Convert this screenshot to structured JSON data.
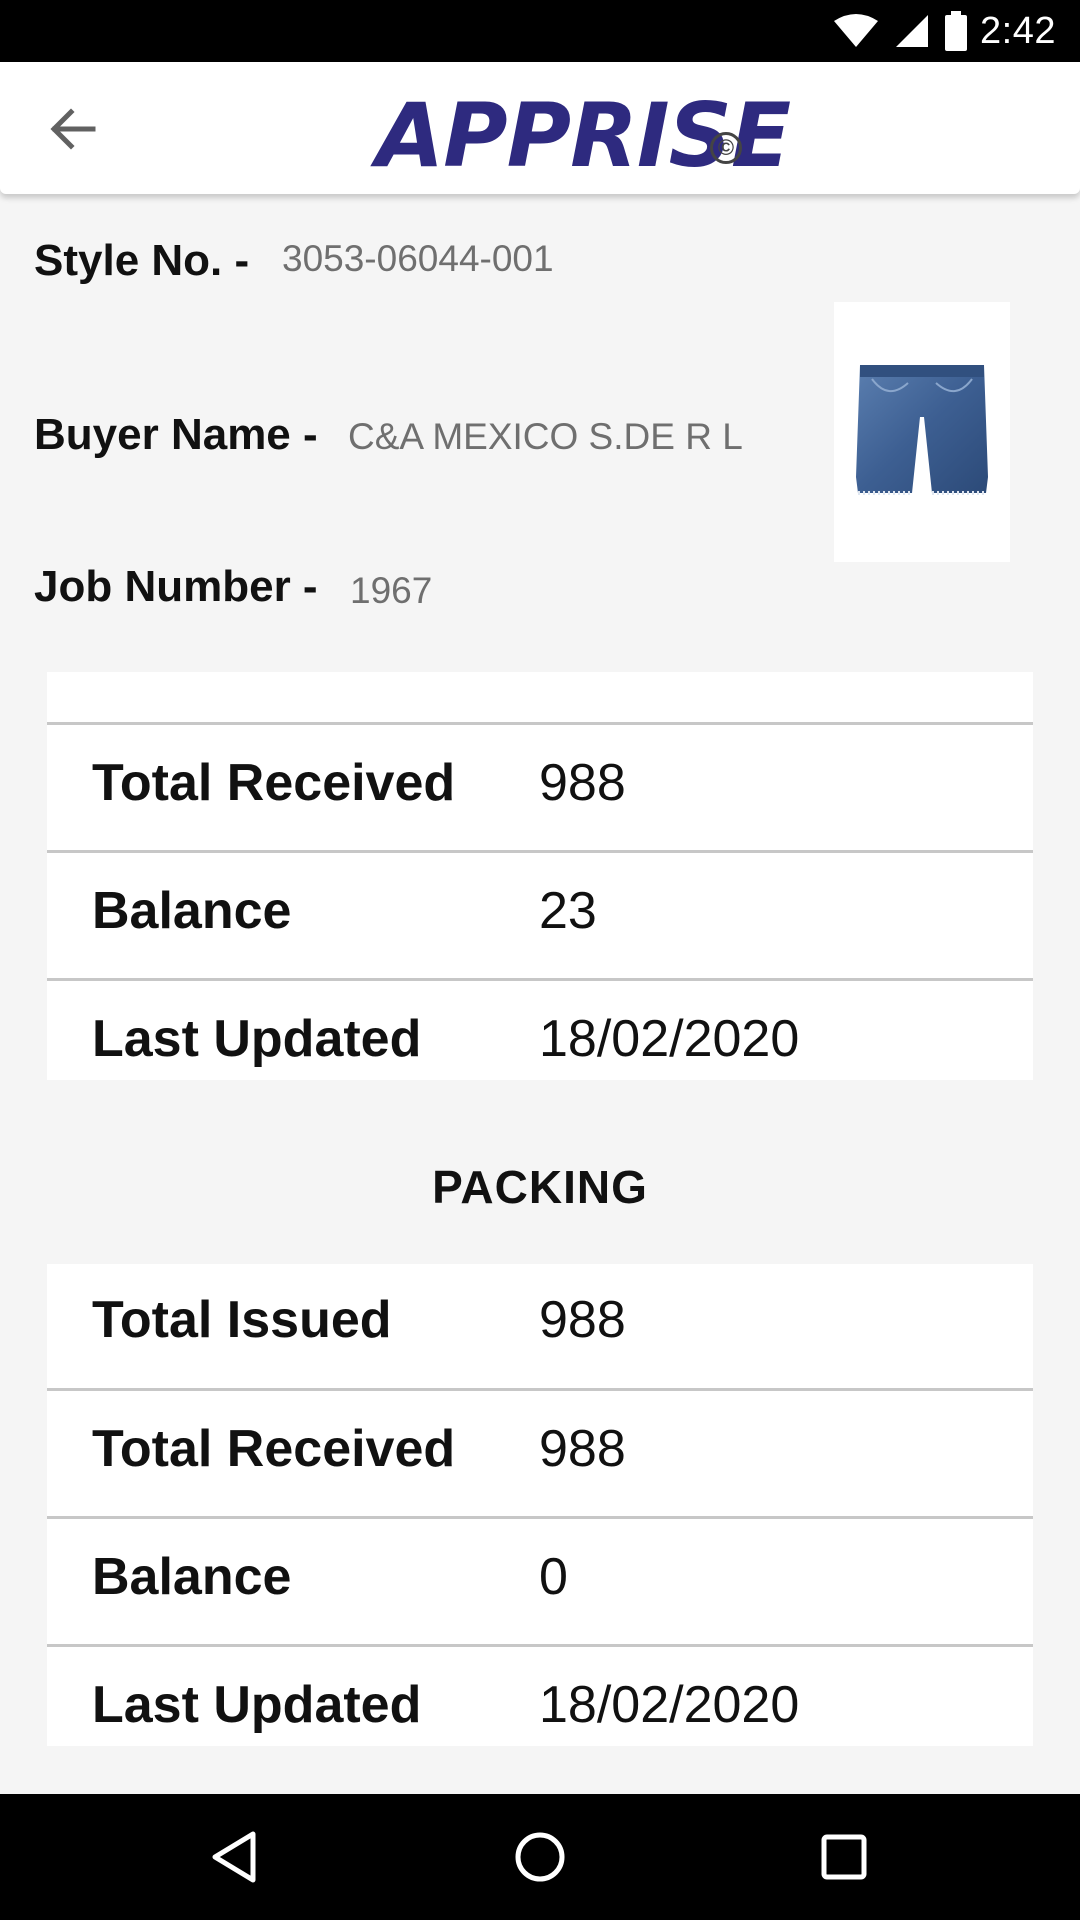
{
  "status_bar": {
    "time": "2:42",
    "icons": [
      "wifi-icon",
      "cellular-signal-icon",
      "battery-icon"
    ]
  },
  "app_bar": {
    "logo_text": "APPRISE",
    "logo_mark": "©",
    "back_icon": "arrow-back-icon",
    "logo_color": "#2e2a7f"
  },
  "details": {
    "style_no": {
      "label": "Style No. -",
      "value": "3053-06044-001"
    },
    "buyer_name": {
      "label": "Buyer Name -",
      "value": "C&A MEXICO S.DE R L"
    },
    "job_number": {
      "label": "Job Number -",
      "value": "1967"
    },
    "product_image": "denim-shorts-image"
  },
  "previous_section": {
    "rows": [
      {
        "key": "Total Received",
        "value": "988"
      },
      {
        "key": "Balance",
        "value": "23"
      },
      {
        "key": "Last Updated",
        "value": "18/02/2020"
      }
    ]
  },
  "packing": {
    "title": "PACKING",
    "rows": [
      {
        "key": "Total Issued",
        "value": "988"
      },
      {
        "key": "Total Received",
        "value": "988"
      },
      {
        "key": "Balance",
        "value": "0"
      },
      {
        "key": "Last Updated",
        "value": "18/02/2020"
      }
    ]
  },
  "nav_bar": {
    "buttons": [
      "back-triangle-icon",
      "home-circle-icon",
      "recents-square-icon"
    ]
  }
}
